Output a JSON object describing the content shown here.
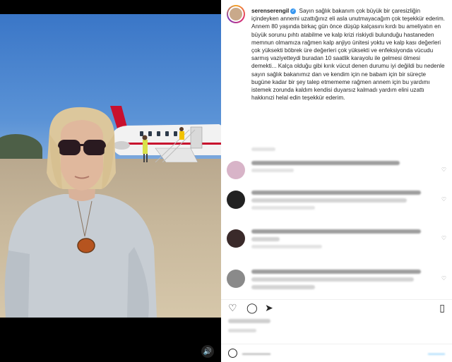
{
  "post": {
    "username": "serenserengil",
    "caption_p1": "Sayın sağlık bakanım çok büyük bir çaresizliğin içindeyken annemi uzattığınız eli asla unutmayacağım çok teşekkür ederim.",
    "caption_p2": "Annem 80 yaşında birkaç gün önce düşüp kalçasını kırdı bu ameliyatın en büyük sorunu pıhtı atabilme ve kalp krizi riskiydi bulunduğu hastaneden memnun olmamıza rağmen kalp anjiyo ünitesi yoktu ve kalp kası değerleri çok yüksekti böbrek üre değerleri çok yüksekti ve enfeksiyonda vücudu sarmış vaziyetteydi buradan 10 saatlik karayolu ile gelmesi ölmesi demekti... Kalça olduğu gibi kırık vücut denen durumu iyi değildi bu nedenle sayın sağlık bakanımız dan ve kendim için ne babam için bir süreçte bugüne kadar bir şey talep etmememe rağmen annem için bu yardımı istemek zorunda kaldım kendisi duyarsız kalmadı yardım elini uzattı hakkınızi helal edin teşekkür ederim."
  },
  "icons": {
    "volume": "volume-icon",
    "like": "heart-icon",
    "comment": "comment-icon",
    "share": "share-icon",
    "save": "bookmark-icon",
    "emoji": "emoji-icon"
  },
  "colors": {
    "verified": "#3897f0",
    "text": "#262626",
    "muted": "#8e8e8e"
  }
}
